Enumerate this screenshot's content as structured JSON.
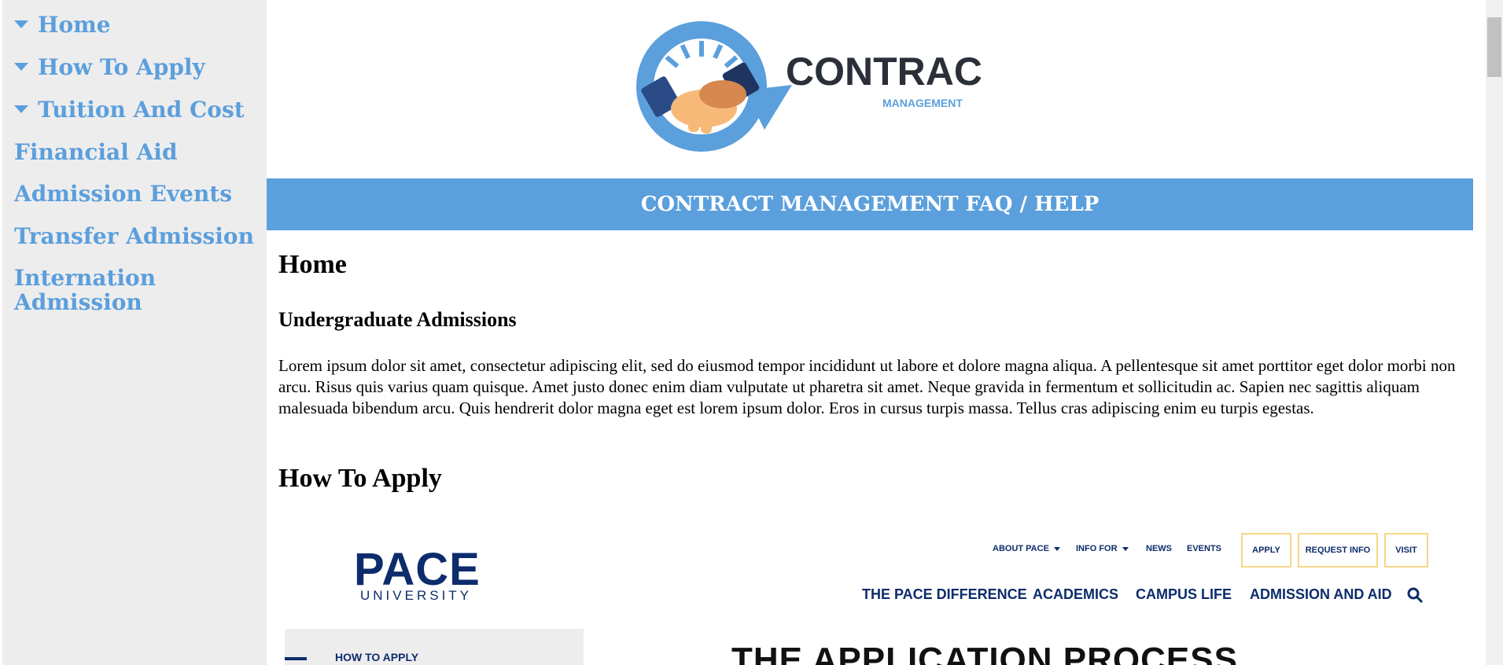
{
  "sidebar": {
    "items": [
      {
        "label": "Home",
        "expandable": true
      },
      {
        "label": "How To Apply",
        "expandable": true
      },
      {
        "label": "Tuition And Cost",
        "expandable": true
      },
      {
        "label": "Financial Aid",
        "expandable": false
      },
      {
        "label": "Admission Events",
        "expandable": false
      },
      {
        "label": "Transfer Admission",
        "expandable": false
      },
      {
        "label": "Internation Admission",
        "expandable": false
      }
    ]
  },
  "logo": {
    "word": "CONTRACT",
    "sub": "MANAGEMENT"
  },
  "banner": {
    "title": "CONTRACT MANAGEMENT FAQ / HELP"
  },
  "sections": {
    "home_heading": "Home",
    "home_subheading": "Undergraduate Admissions",
    "home_paragraph": "Lorem ipsum dolor sit amet, consectetur adipiscing elit, sed do eiusmod tempor incididunt ut labore et dolore magna aliqua. A pellentesque sit amet porttitor eget dolor morbi non arcu. Risus quis varius quam quisque. Amet justo donec enim diam vulputate ut pharetra sit amet. Neque gravida in fermentum et sollicitudin ac. Sapien nec sagittis aliquam malesuada bibendum arcu. Quis hendrerit dolor magna eget est lorem ipsum dolor. Eros in cursus turpis massa. Tellus cras adipiscing enim eu turpis egestas.",
    "apply_heading": "How To Apply"
  },
  "embedded": {
    "logo": "PACE",
    "logo_sub": "UNIVERSITY",
    "utility_links": [
      "ABOUT PACE",
      "INFO FOR",
      "NEWS",
      "EVENTS"
    ],
    "outlined_buttons": [
      "APPLY",
      "REQUEST INFO",
      "VISIT"
    ],
    "main_nav": [
      "THE PACE DIFFERENCE",
      "ACADEMICS",
      "CAMPUS LIFE",
      "ADMISSION AND AID"
    ],
    "side_label": "HOW TO APPLY",
    "page_title": "THE APPLICATION PROCESS"
  },
  "colors": {
    "accent": "#5b9fdc",
    "sidebar_bg": "#eeedee",
    "pace_navy": "#0c2c6b",
    "pace_gold": "#f6d78a"
  }
}
